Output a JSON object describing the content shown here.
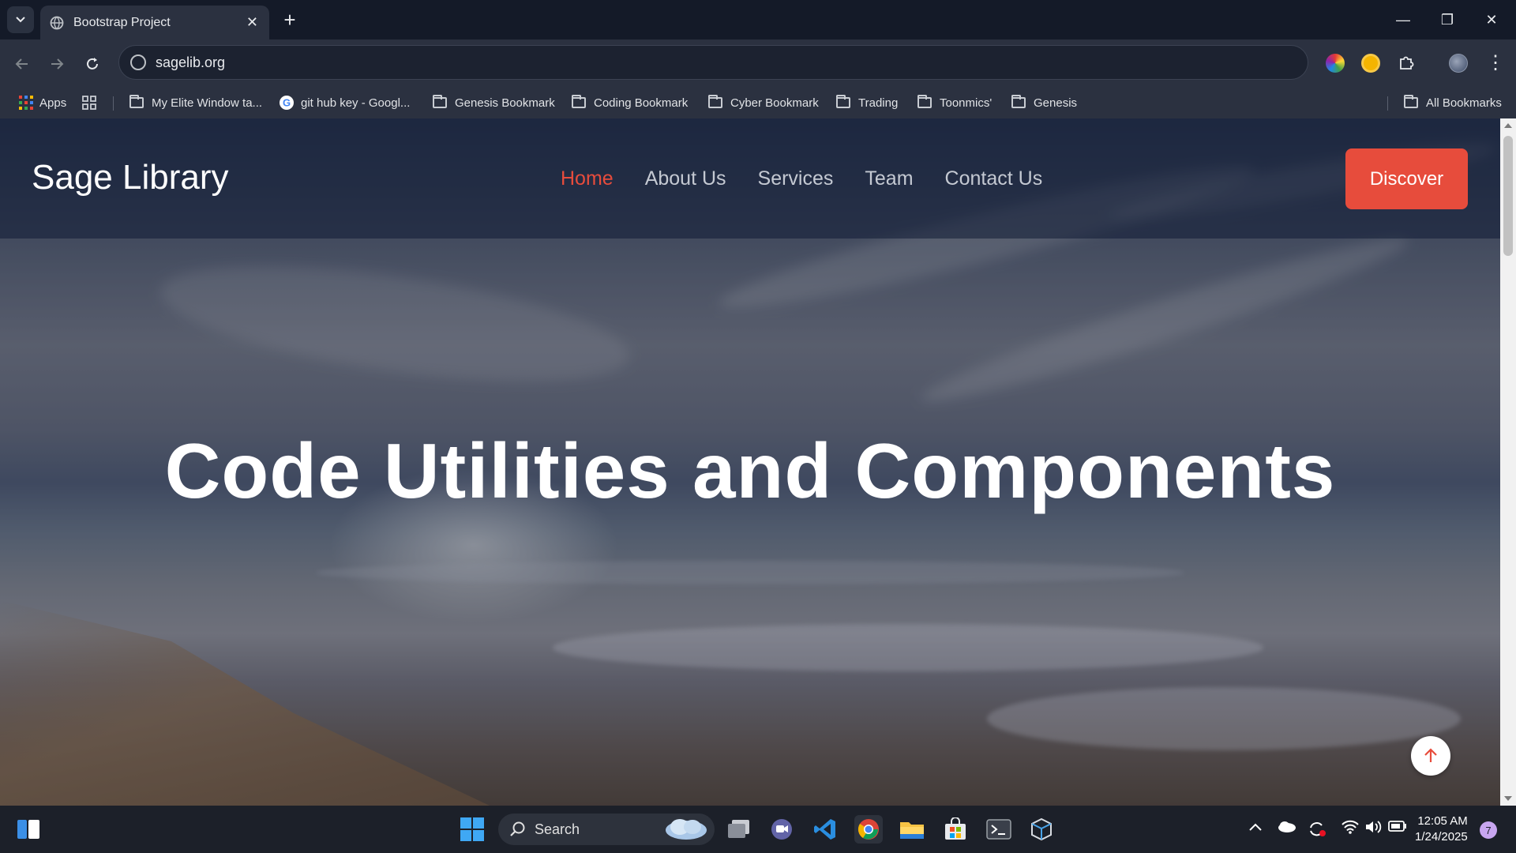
{
  "browser": {
    "tab_title": "Bootstrap Project",
    "tab_close": "✕",
    "new_tab": "+",
    "url": "sagelib.org",
    "window_controls": {
      "minimize": "—",
      "restore": "❐",
      "close": "✕"
    }
  },
  "bookmarks": {
    "apps_label": "Apps",
    "items": [
      "My Elite Window ta...",
      "git hub key - Googl...",
      "Genesis Bookmark",
      "Coding Bookmark",
      "Cyber Bookmark",
      "Trading",
      "Toonmics'",
      "Genesis"
    ],
    "all_bookmarks": "All Bookmarks"
  },
  "site": {
    "brand": "Sage Library",
    "nav": [
      "Home",
      "About Us",
      "Services",
      "Team",
      "Contact Us"
    ],
    "active_nav": "Home",
    "cta": "Discover",
    "hero_title": "Code Utilities and Components",
    "to_top_icon": "arrow-up-icon",
    "accent_color": "#e74c3c"
  },
  "taskbar": {
    "search_label": "Search",
    "time": "12:05 AM",
    "date": "1/24/2025",
    "notification_count": "7"
  }
}
